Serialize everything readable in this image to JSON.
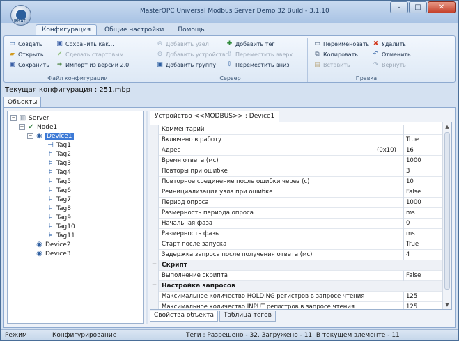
{
  "window": {
    "title": "MasterOPC Universal Modbus Server Demo 32 Build - 3.1.10",
    "orb_text": "INSAT",
    "controls": {
      "minimize": "–",
      "maximize": "□",
      "close": "✕"
    }
  },
  "ribbon": {
    "tabs": [
      {
        "label": "Конфигурация",
        "active": true
      },
      {
        "label": "Общие настройки",
        "active": false
      },
      {
        "label": "Помощь",
        "active": false
      }
    ],
    "groups": {
      "file": {
        "label": "Файл конфигурации",
        "items": [
          {
            "label": "Создать",
            "icon": "new-file-icon",
            "glyph": "🗋",
            "disabled": false
          },
          {
            "label": "Открыть",
            "icon": "open-folder-icon",
            "glyph": "📂",
            "disabled": false
          },
          {
            "label": "Сохранить",
            "icon": "save-icon",
            "glyph": "💾",
            "disabled": false
          },
          {
            "label": "Сохранить как...",
            "icon": "save-as-icon",
            "glyph": "🖫",
            "disabled": false
          },
          {
            "label": "Сделать стартовым",
            "icon": "checkmark-icon",
            "glyph": "✔",
            "disabled": true
          },
          {
            "label": "Импорт из версии 2.0",
            "icon": "import-icon",
            "glyph": "⇲",
            "disabled": false
          }
        ]
      },
      "server": {
        "label": "Сервер",
        "items": [
          {
            "label": "Добавить узел",
            "icon": "add-node-icon",
            "glyph": "⊕",
            "disabled": true
          },
          {
            "label": "Добавить устройство",
            "icon": "add-device-icon",
            "glyph": "⊕",
            "disabled": true
          },
          {
            "label": "Добавить группу",
            "icon": "add-group-icon",
            "glyph": "▣",
            "disabled": false
          },
          {
            "label": "Добавить тег",
            "icon": "add-tag-icon",
            "glyph": "✚",
            "disabled": false
          },
          {
            "label": "Переместить вверх",
            "icon": "move-up-icon",
            "glyph": "⇧",
            "disabled": true
          },
          {
            "label": "Переместить вниз",
            "icon": "move-down-icon",
            "glyph": "⇩",
            "disabled": false
          }
        ]
      },
      "edit": {
        "label": "Правка",
        "items": [
          {
            "label": "Переименовать",
            "icon": "rename-icon",
            "glyph": "▭",
            "disabled": false
          },
          {
            "label": "Копировать",
            "icon": "copy-icon",
            "glyph": "⧉",
            "disabled": false
          },
          {
            "label": "Вставить",
            "icon": "paste-icon",
            "glyph": "📋",
            "disabled": true
          },
          {
            "label": "Удалить",
            "icon": "delete-icon",
            "glyph": "✖",
            "disabled": false
          },
          {
            "label": "Отменить",
            "icon": "undo-icon",
            "glyph": "↶",
            "disabled": false
          },
          {
            "label": "Вернуть",
            "icon": "redo-icon",
            "glyph": "↷",
            "disabled": true
          }
        ]
      }
    }
  },
  "config_line": "Текущая конфигурация : 251.mbp",
  "objects_tab": "Объекты",
  "tree": {
    "server": "Server",
    "node": "Node1",
    "device_selected": "Device1",
    "tags": [
      "Tag1",
      "Tag2",
      "Tag3",
      "Tag4",
      "Tag5",
      "Tag6",
      "Tag7",
      "Tag8",
      "Tag9",
      "Tag10",
      "Tag11"
    ],
    "device2": "Device2",
    "device3": "Device3",
    "expand_open": "−"
  },
  "panel": {
    "doc_tab": "Устройство <<MODBUS>> : Device1",
    "bottom_tabs": [
      "Свойства объекта",
      "Таблица тегов"
    ],
    "scroll_up": "▲",
    "scroll_down": "▼",
    "rows": [
      {
        "name": "Комментарий",
        "value": ""
      },
      {
        "name": "Включено в работу",
        "value": "True"
      },
      {
        "name": "Адрес",
        "extra": "(0x10)",
        "value": "16"
      },
      {
        "name": "Время ответа (мс)",
        "value": "1000"
      },
      {
        "name": "Повторы при ошибке",
        "value": "3"
      },
      {
        "name": "Повторное соединение после ошибки через (с)",
        "value": "10"
      },
      {
        "name": "Реинициализация узла при ошибке",
        "value": "False"
      },
      {
        "name": "Период опроса",
        "value": "1000"
      },
      {
        "name": "Размерность периода опроса",
        "value": "ms"
      },
      {
        "name": "Начальная фаза",
        "value": "0"
      },
      {
        "name": "Размерность фазы",
        "value": "ms"
      },
      {
        "name": "Старт после запуска",
        "value": "True"
      },
      {
        "name": "Задержка запроса после получения ответа (мс)",
        "value": "4"
      },
      {
        "name": "Скрипт",
        "category": true,
        "toggle": "−"
      },
      {
        "name": "Выполнение скрипта",
        "value": "False"
      },
      {
        "name": "Настройка запросов",
        "category": true,
        "toggle": "−"
      },
      {
        "name": "Максимальное количество HOLDING регистров в запросе чтения",
        "value": "125"
      },
      {
        "name": "Максимальное количество INPUT регистров в запросе чтения",
        "value": "125"
      }
    ]
  },
  "status": {
    "mode_label": "Режим",
    "mode_value": "Конфигурирование",
    "tags_info": "Теги : Разрешено - 32. Загружено - 11. В текущем элементе - 11"
  }
}
